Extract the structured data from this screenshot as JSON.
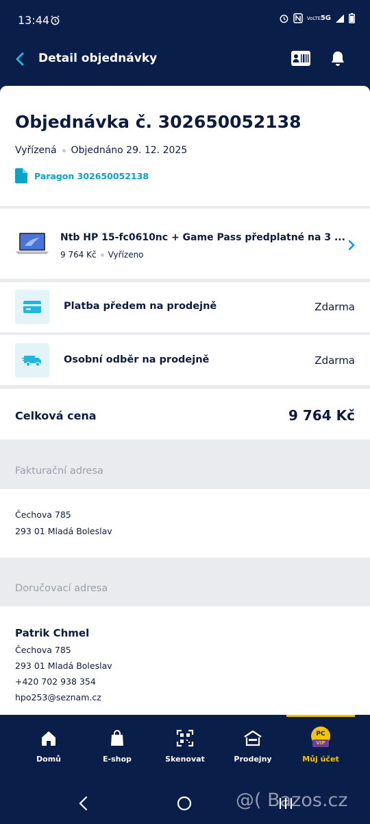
{
  "status_bar": {
    "time": "13:44",
    "network": "5G",
    "volte": "VoLTE"
  },
  "app_bar": {
    "title": "Detail objednávky"
  },
  "order": {
    "title": "Objednávka č. 302650052138",
    "status": "Vyřízená",
    "ordered": "Objednáno 29. 12. 2025",
    "receipt_label": "Paragon 302650052138"
  },
  "product": {
    "name": "Ntb HP 15-fc0610nc + Game Pass předplatné na 3 ...",
    "price": "9 764 Kč",
    "status": "Vyřízeno"
  },
  "payment": {
    "label": "Platba předem na prodejně",
    "value": "Zdarma"
  },
  "shipping": {
    "label": "Osobní odběr na prodejně",
    "value": "Zdarma"
  },
  "total": {
    "label": "Celková cena",
    "value": "9 764 Kč"
  },
  "billing": {
    "heading": "Fakturační adresa",
    "street": "Čechova 785",
    "city": "293 01 Mladá Boleslav"
  },
  "delivery": {
    "heading": "Doručovací adresa",
    "name": "Patrik Chmel",
    "street": "Čechova 785",
    "city": "293 01 Mladá Boleslav",
    "phone": "+420 702 938 354",
    "email": "hpo253@seznam.cz"
  },
  "bottom_nav": {
    "items": [
      {
        "label": "Domů",
        "icon": "home-icon"
      },
      {
        "label": "E-shop",
        "icon": "shopping-bag-icon"
      },
      {
        "label": "Skenovat",
        "icon": "scan-icon"
      },
      {
        "label": "Prodejny",
        "icon": "store-icon"
      },
      {
        "label": "Můj účet",
        "icon": "vip-account-icon",
        "badge_top": "PC",
        "badge_bottom": "VIP"
      }
    ],
    "active_index": 4
  },
  "watermark": "@( Bazos.cz",
  "colors": {
    "navy": "#0a1e4a",
    "accent": "#0aa3c9",
    "active": "#f5c400"
  }
}
